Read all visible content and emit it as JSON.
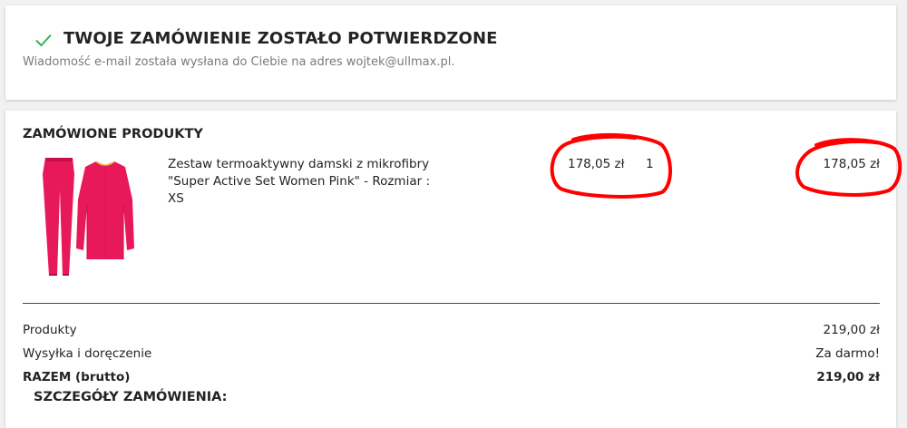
{
  "confirmation": {
    "icon": "check-icon",
    "accent_color": "#2fb55d",
    "title": "TWOJE ZAMÓWIENIE ZOSTAŁO POTWIERDZONE",
    "subtitle": "Wiadomość e-mail została wysłana do Ciebie na adres wojtek@ullmax.pl."
  },
  "order": {
    "products_title": "ZAMÓWIONE PRODUKTY",
    "items": [
      {
        "name": "Zestaw termoaktywny damski z mikrofibry \"Super Active Set Women Pink\" - Rozmiar : XS",
        "unit_price": "178,05 zł",
        "quantity": "1",
        "total": "178,05 zł",
        "image_icon": "pink-thermal-set-image",
        "product_color": "#e8195a"
      }
    ],
    "annotation_color": "#ff0000",
    "summary": [
      {
        "label": "Produkty",
        "value": "219,00 zł"
      },
      {
        "label": "Wysyłka i doręczenie",
        "value": "Za darmo!"
      },
      {
        "label": "RAZEM (brutto)",
        "value": "219,00 zł"
      }
    ],
    "details_title": "SZCZEGÓŁY ZAMÓWIENIA:"
  }
}
